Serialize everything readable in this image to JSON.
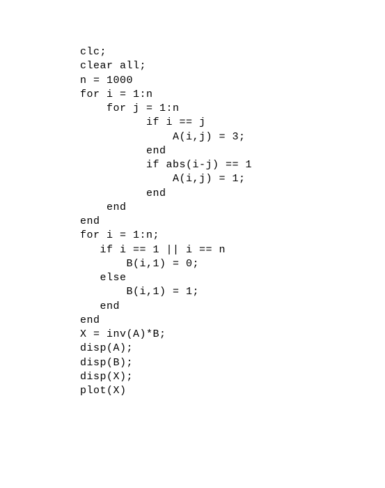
{
  "code": {
    "lines": [
      "clc;",
      "clear all;",
      "",
      "n = 1000",
      "",
      "for i = 1:n",
      "    for j = 1:n",
      "          if i == j",
      "              A(i,j) = 3;",
      "          end",
      "          if abs(i-j) == 1",
      "              A(i,j) = 1;",
      "          end",
      "    end",
      "end",
      "",
      "for i = 1:n;",
      "   if i == 1 || i == n",
      "       B(i,1) = 0;",
      "   else",
      "       B(i,1) = 1;",
      "   end",
      "end",
      "",
      "X = inv(A)*B;",
      "",
      "disp(A);",
      "disp(B);",
      "disp(X);",
      "",
      "plot(X)"
    ]
  }
}
